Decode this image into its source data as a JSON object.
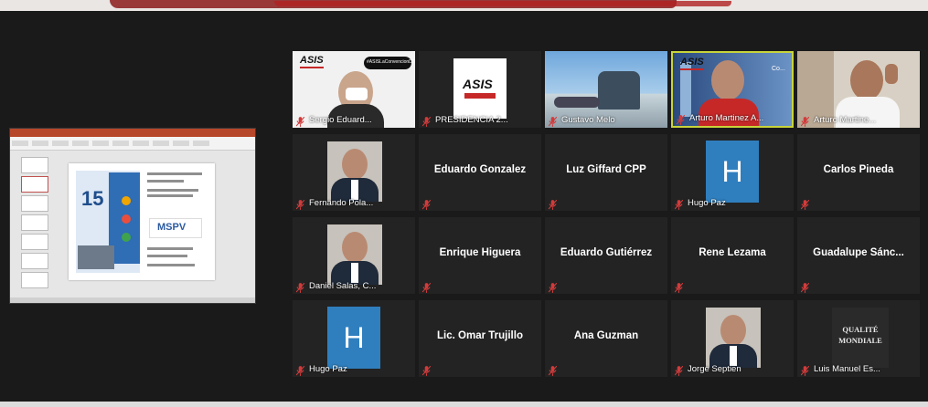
{
  "shared_screen": {
    "slide_number": "15"
  },
  "grid": [
    {
      "name": "Sergio Eduard...",
      "type": "video",
      "label": "ASIS",
      "badge": "#ASISLaConvencionDSS2021"
    },
    {
      "name": "PRESIDENCIA 2...",
      "type": "logo",
      "label": "ASIS"
    },
    {
      "name": "Gustavo Melo",
      "type": "video"
    },
    {
      "name": "Arturo Martinez A...",
      "type": "video",
      "label": "ASIS",
      "overlay": "Co..."
    },
    {
      "name": "Arturo Martine...",
      "type": "video"
    },
    {
      "name": "Fernando Pola...",
      "type": "photo"
    },
    {
      "name": "",
      "type": "text",
      "display": "Eduardo Gonzalez"
    },
    {
      "name": "",
      "type": "text",
      "display": "Luz Giffard CPP"
    },
    {
      "name": "Hugo Paz",
      "type": "initial",
      "initial": "H"
    },
    {
      "name": "",
      "type": "text",
      "display": "Carlos Pineda"
    },
    {
      "name": "Daniel Salas, C...",
      "type": "photo"
    },
    {
      "name": "",
      "type": "text",
      "display": "Enrique Higuera"
    },
    {
      "name": "",
      "type": "text",
      "display": "Eduardo Gutiérrez"
    },
    {
      "name": "",
      "type": "text",
      "display": "Rene Lezama"
    },
    {
      "name": "",
      "type": "text",
      "display": "Guadalupe  Sánc..."
    },
    {
      "name": "Hugo Paz",
      "type": "initial",
      "initial": "H"
    },
    {
      "name": "",
      "type": "text",
      "display": "Lic. Omar Trujillo"
    },
    {
      "name": "",
      "type": "text",
      "display": "Ana Guzman"
    },
    {
      "name": "Jorge Septien",
      "type": "photo"
    },
    {
      "name": "Luis Manuel Es...",
      "type": "logo",
      "label": "QUALITÉ MONDIALE"
    }
  ],
  "colors": {
    "active_speaker": "#c8d43a",
    "muted_icon": "#d23b3b",
    "tile_bg": "#232323"
  },
  "icons": {
    "mute": "muted-mic-icon"
  }
}
